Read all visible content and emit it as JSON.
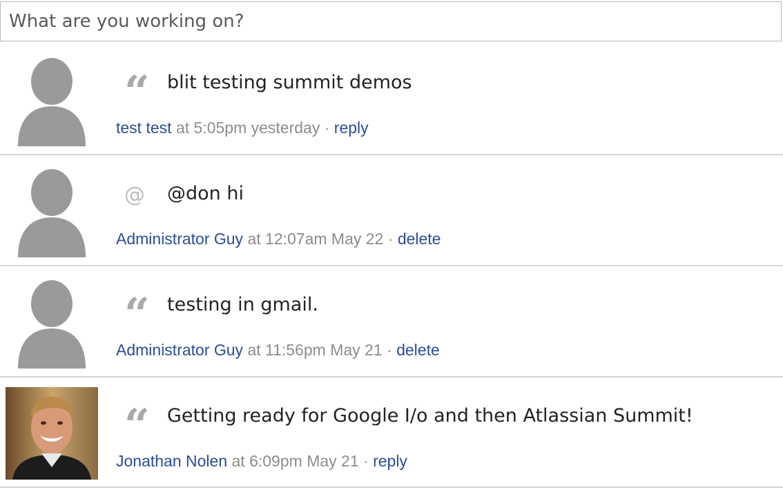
{
  "composer": {
    "placeholder": "What are you working on?"
  },
  "feed": [
    {
      "icon": "quote-icon",
      "message": "blit testing summit demos",
      "author": "test test",
      "time": "at 5:05pm yesterday",
      "separator": "·",
      "action": "reply"
    },
    {
      "icon": "at-icon",
      "icon_glyph": "@",
      "message": "@don hi",
      "author": "Administrator Guy",
      "time": "at 12:07am May 22",
      "separator": "·",
      "action": "delete"
    },
    {
      "icon": "quote-icon",
      "message": "testing in gmail.",
      "author": "Administrator Guy",
      "time": "at 11:56pm May 21",
      "separator": "·",
      "action": "delete"
    },
    {
      "icon": "quote-icon",
      "message": "Getting ready for Google I/o and then Atlassian Summit!",
      "author": "Jonathan Nolen",
      "time": "at 6:09pm May 21",
      "separator": "·",
      "action": "reply"
    }
  ],
  "colors": {
    "link": "#2a4d9a",
    "meta": "#8c8c8c",
    "avatar_placeholder": "#9a9a9a",
    "divider": "#d4d4d4"
  }
}
